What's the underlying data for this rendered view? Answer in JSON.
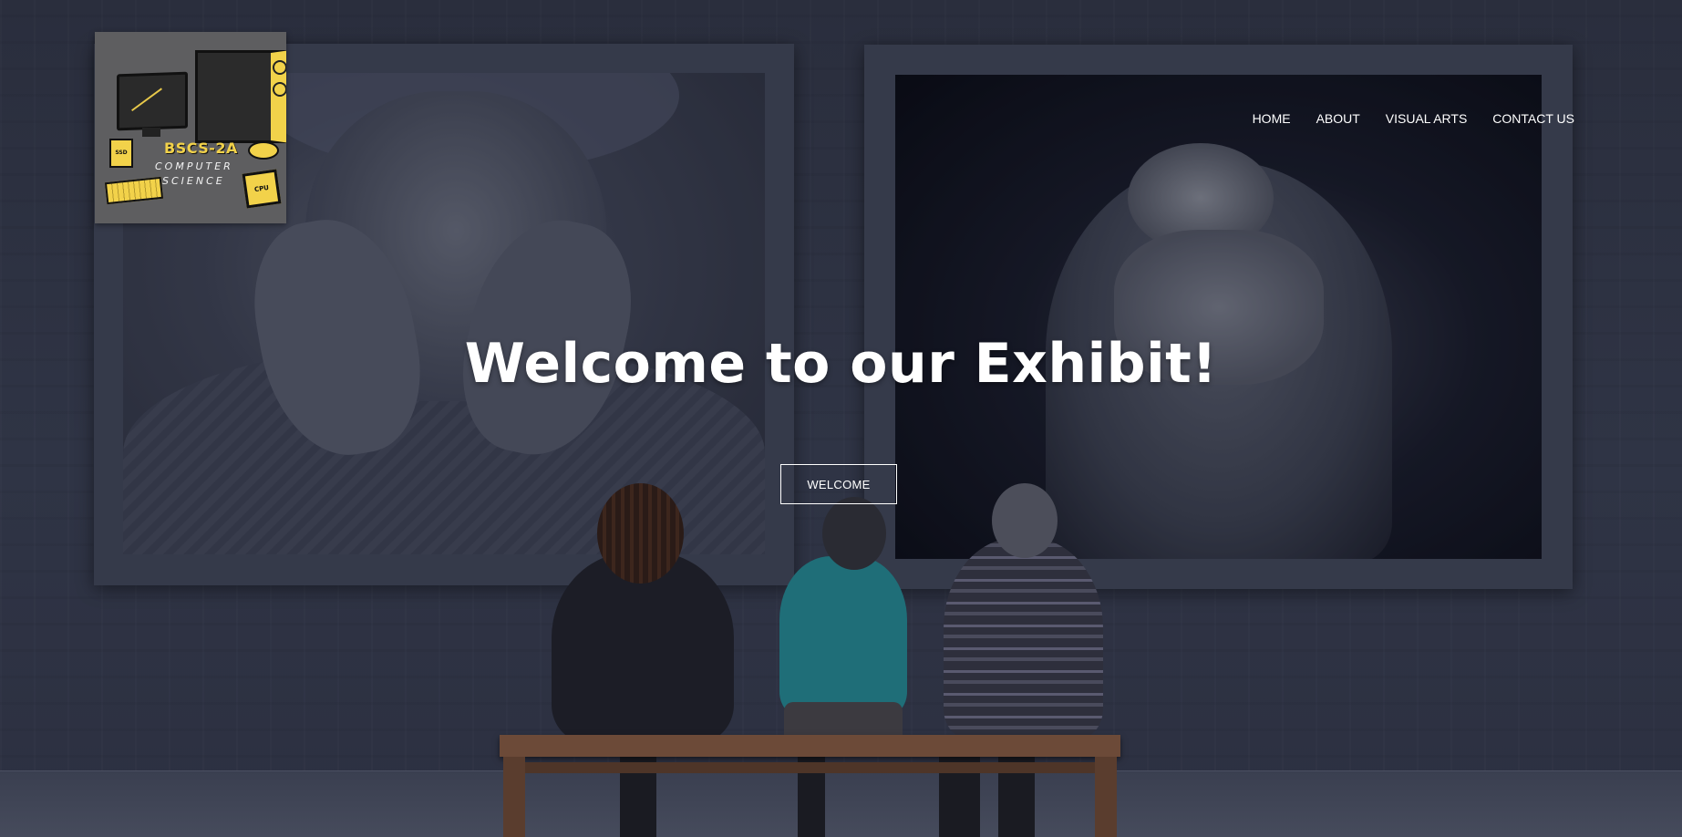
{
  "logo": {
    "title": "BSCS-2A",
    "subtitle_line1": "COMPUTER",
    "subtitle_line2": "SCIENCE",
    "ssd_label": "SSD",
    "cpu_label": "CPU",
    "accent_color": "#f2d24a"
  },
  "nav": {
    "items": [
      {
        "label": "HOME"
      },
      {
        "label": "ABOUT"
      },
      {
        "label": "VISUAL ARTS"
      },
      {
        "label": "CONTACT US"
      }
    ]
  },
  "hero": {
    "title": "Welcome to our Exhibit!",
    "button_label": "WELCOME"
  }
}
